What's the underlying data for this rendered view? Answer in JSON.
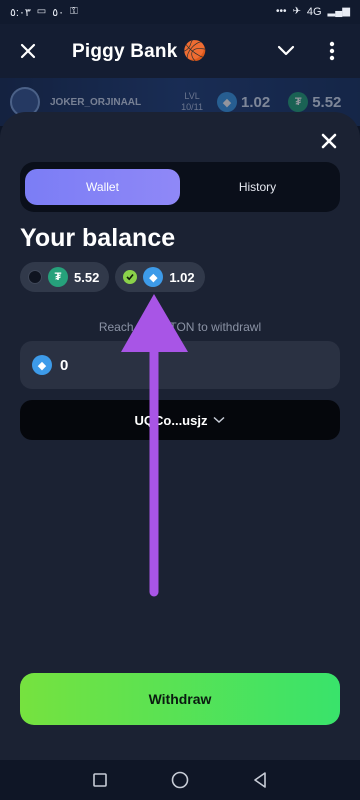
{
  "status_bar": {
    "time": "٥:٠٣",
    "battery_level": "٥٠",
    "signal": "4G"
  },
  "header": {
    "title": "Piggy Bank 🏀"
  },
  "game_strip": {
    "username": "JOKER_ORJINAAL",
    "level_label": "LVL",
    "level_value": "10/11",
    "ton_amount": "1.02",
    "usdt_amount": "5.52"
  },
  "tabs": [
    {
      "label": "Wallet",
      "active": true
    },
    {
      "label": "History",
      "active": false
    }
  ],
  "balance": {
    "title": "Your balance",
    "chips": [
      {
        "currency": "USDT",
        "icon": "tether-icon",
        "amount": "5.52",
        "selected": false
      },
      {
        "currency": "TON",
        "icon": "ton-icon",
        "amount": "1.02",
        "selected": true
      }
    ]
  },
  "withdraw_form": {
    "hint": "Reach min 1 TON to withdrawl",
    "amount_value": "0",
    "wallet_address": "UQCo...usjz"
  },
  "actions": {
    "withdraw_label": "Withdraw"
  },
  "colors": {
    "accent_purple": "#8f88f7",
    "withdraw_green": "#5be355",
    "annotation_arrow": "#a855e6"
  }
}
